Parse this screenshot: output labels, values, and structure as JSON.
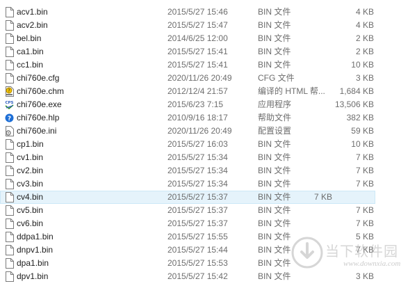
{
  "files": [
    {
      "name": "acv1.bin",
      "date": "2015/5/27 15:46",
      "type": "BIN 文件",
      "size": "4 KB",
      "icon": "file-icon"
    },
    {
      "name": "acv2.bin",
      "date": "2015/5/27 15:47",
      "type": "BIN 文件",
      "size": "4 KB",
      "icon": "file-icon"
    },
    {
      "name": "bel.bin",
      "date": "2014/6/25 12:00",
      "type": "BIN 文件",
      "size": "2 KB",
      "icon": "file-icon"
    },
    {
      "name": "ca1.bin",
      "date": "2015/5/27 15:41",
      "type": "BIN 文件",
      "size": "2 KB",
      "icon": "file-icon"
    },
    {
      "name": "cc1.bin",
      "date": "2015/5/27 15:41",
      "type": "BIN 文件",
      "size": "10 KB",
      "icon": "file-icon"
    },
    {
      "name": "chi760e.cfg",
      "date": "2020/11/26 20:49",
      "type": "CFG 文件",
      "size": "3 KB",
      "icon": "file-icon"
    },
    {
      "name": "chi760e.chm",
      "date": "2012/12/4 21:57",
      "type": "编译的 HTML 帮...",
      "size": "1,684 KB",
      "icon": "chm-help-icon"
    },
    {
      "name": "chi760e.exe",
      "date": "2015/6/23 7:15",
      "type": "应用程序",
      "size": "13,506 KB",
      "icon": "exe-app-icon"
    },
    {
      "name": "chi760e.hlp",
      "date": "2010/9/16 18:17",
      "type": "帮助文件",
      "size": "382 KB",
      "icon": "help-icon"
    },
    {
      "name": "chi760e.ini",
      "date": "2020/11/26 20:49",
      "type": "配置设置",
      "size": "59 KB",
      "icon": "settings-file-icon"
    },
    {
      "name": "cp1.bin",
      "date": "2015/5/27 16:03",
      "type": "BIN 文件",
      "size": "10 KB",
      "icon": "file-icon"
    },
    {
      "name": "cv1.bin",
      "date": "2015/5/27 15:34",
      "type": "BIN 文件",
      "size": "7 KB",
      "icon": "file-icon"
    },
    {
      "name": "cv2.bin",
      "date": "2015/5/27 15:34",
      "type": "BIN 文件",
      "size": "7 KB",
      "icon": "file-icon"
    },
    {
      "name": "cv3.bin",
      "date": "2015/5/27 15:34",
      "type": "BIN 文件",
      "size": "7 KB",
      "icon": "file-icon"
    },
    {
      "name": "cv4.bin",
      "date": "2015/5/27 15:37",
      "type": "BIN 文件",
      "size": "7 KB",
      "icon": "file-icon",
      "selected": true
    },
    {
      "name": "cv5.bin",
      "date": "2015/5/27 15:37",
      "type": "BIN 文件",
      "size": "7 KB",
      "icon": "file-icon"
    },
    {
      "name": "cv6.bin",
      "date": "2015/5/27 15:37",
      "type": "BIN 文件",
      "size": "7 KB",
      "icon": "file-icon"
    },
    {
      "name": "ddpa1.bin",
      "date": "2015/5/27 15:55",
      "type": "BIN 文件",
      "size": "5 KB",
      "icon": "file-icon"
    },
    {
      "name": "dnpv1.bin",
      "date": "2015/5/27 15:44",
      "type": "BIN 文件",
      "size": "7 KB",
      "icon": "file-icon"
    },
    {
      "name": "dpa1.bin",
      "date": "2015/5/27 15:53",
      "type": "BIN 文件",
      "size": "",
      "icon": "file-icon"
    },
    {
      "name": "dpv1.bin",
      "date": "2015/5/27 15:42",
      "type": "BIN 文件",
      "size": "3 KB",
      "icon": "file-icon"
    }
  ],
  "watermark": {
    "title": "当下软件园",
    "url": "www.downxia.com",
    "icon": "downxia-logo-icon"
  },
  "colors": {
    "selected_bg": "#e5f3fb",
    "meta_text": "#6d6d6d"
  }
}
